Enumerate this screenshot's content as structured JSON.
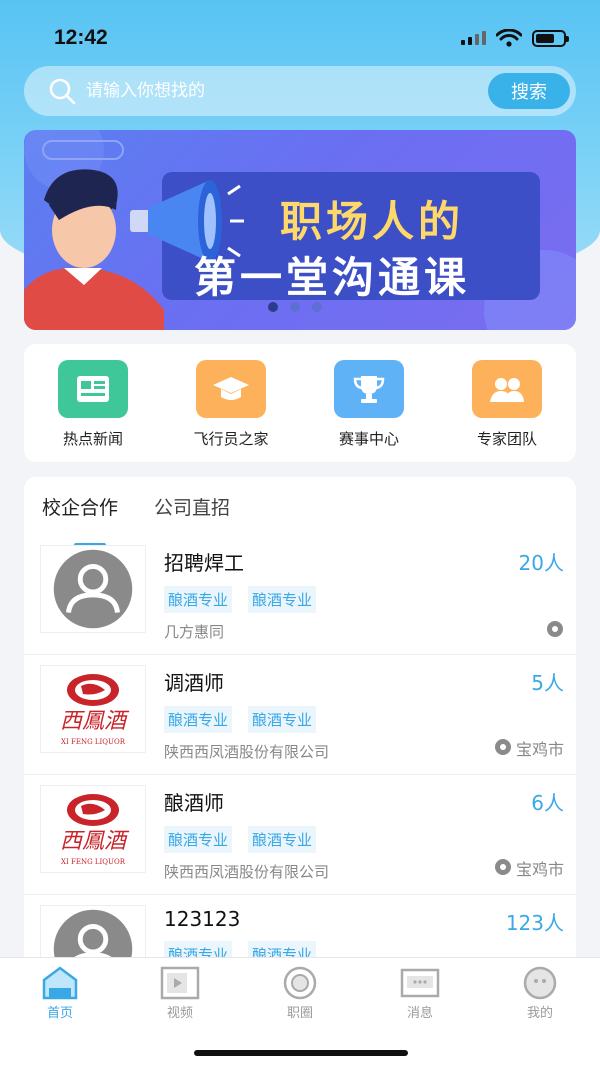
{
  "status_bar": {
    "time": "12:42"
  },
  "search": {
    "placeholder": "请输入你想找的",
    "button_label": "搜索"
  },
  "banner": {
    "line1": "职场人的",
    "line2": "第一堂沟通课",
    "dot_count": 3,
    "active_dot": 0
  },
  "quick_links": [
    {
      "label": "热点新闻",
      "icon": "news-icon",
      "color": "#3fc79a"
    },
    {
      "label": "飞行员之家",
      "icon": "graduation-cap-icon",
      "color": "#fdb15a"
    },
    {
      "label": "赛事中心",
      "icon": "trophy-icon",
      "color": "#5fb2f6"
    },
    {
      "label": "专家团队",
      "icon": "team-icon",
      "color": "#fdb15a"
    }
  ],
  "tabs": [
    {
      "label": "校企合作",
      "active": true
    },
    {
      "label": "公司直招",
      "active": false
    }
  ],
  "jobs": [
    {
      "title": "招聘焊工",
      "count": "20人",
      "tags": [
        "酿酒专业",
        "酿酒专业"
      ],
      "company": "几方惠同",
      "location": "",
      "logo": "avatar-placeholder"
    },
    {
      "title": "调酒师",
      "count": "5人",
      "tags": [
        "酿酒专业",
        "酿酒专业"
      ],
      "company": "陕西西凤酒股份有限公司",
      "location": "宝鸡市",
      "logo": "xifeng-logo"
    },
    {
      "title": "酿酒师",
      "count": "6人",
      "tags": [
        "酿酒专业",
        "酿酒专业"
      ],
      "company": "陕西西凤酒股份有限公司",
      "location": "宝鸡市",
      "logo": "xifeng-logo"
    },
    {
      "title": "123123",
      "count": "123人",
      "tags": [
        "酿酒专业",
        "酿酒专业"
      ],
      "company": "",
      "location": "",
      "logo": "avatar-placeholder"
    }
  ],
  "logo_text": {
    "brand": "西鳳酒",
    "brand_en": "XI FENG LIQUOR"
  },
  "tabbar": [
    {
      "label": "首页",
      "icon": "home-icon",
      "active": true
    },
    {
      "label": "视频",
      "icon": "video-icon",
      "active": false
    },
    {
      "label": "职圈",
      "icon": "circle-icon",
      "active": false
    },
    {
      "label": "消息",
      "icon": "message-icon",
      "active": false
    },
    {
      "label": "我的",
      "icon": "profile-icon",
      "active": false
    }
  ],
  "colors": {
    "accent": "#3aa8e6",
    "header_gradient_top": "#58c3f3"
  }
}
